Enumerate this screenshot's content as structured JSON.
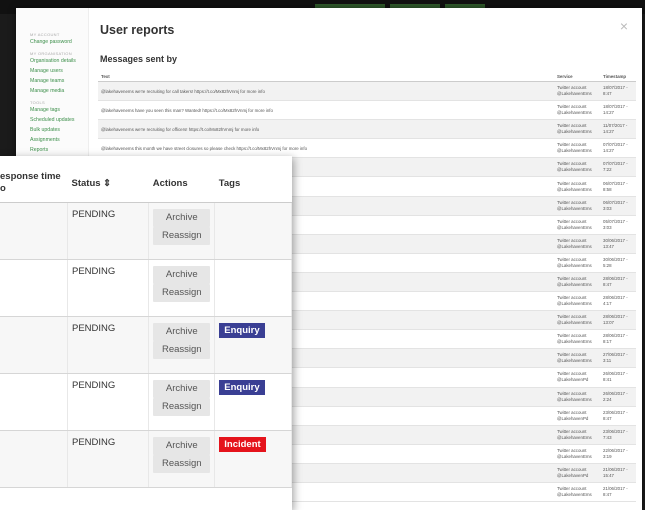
{
  "back": {
    "close_icon": "×",
    "sidebar": {
      "sec_account": "My Account",
      "change_password": "Change password",
      "sec_org": "My Organisation",
      "links": [
        "Organisation details",
        "Manage users",
        "Manage teams",
        "Manage media"
      ],
      "sec_tools": "Tools",
      "links2": [
        "Manage tags",
        "Scheduled updates",
        "Bulk updates",
        "Assignments",
        "Reports"
      ]
    },
    "title": "User reports",
    "subtitle": "Messages sent by",
    "columns": [
      "Text",
      "Service",
      "Timestamp"
    ],
    "rows": [
      {
        "text": "@lakehavenems we're recruiting for call takers! https://t.co/Mx82hVnmj for more info",
        "service": "Twitter account @LakehavenEms",
        "ts": "18/07/2017 - 8:47"
      },
      {
        "text": "@lakehavenems have you seen this man? Wanted! https://t.co/Mx82hVnmj for more info",
        "service": "Twitter account @LakehavenEms",
        "ts": "18/07/2017 - 14:27"
      },
      {
        "text": "@lakehavenems we're recruiting for officers! https://t.co/Mx82hVnmj for more info",
        "service": "Twitter account @LakehavenEms",
        "ts": "11/07/2017 - 14:27"
      },
      {
        "text": "@lakehavenems this month we have street closures so please check https://t.co/Mx82hVnmj for more info",
        "service": "Twitter account @LakehavenEms",
        "ts": "07/07/2017 - 14:27"
      },
      {
        "text": "s/Mx82hVnmj for more info",
        "service": "Twitter account @LakehavenEms",
        "ts": "07/07/2017 - 7:22"
      },
      {
        "text": "co/Mx82hVnmj for more info",
        "service": "Twitter account @LakehavenEms",
        "ts": "06/07/2017 - 8:58"
      },
      {
        "text": "info",
        "service": "Twitter account @LakehavenEms",
        "ts": "06/07/2017 - 3:03"
      },
      {
        "text": "more info",
        "service": "Twitter account @LakehavenEms",
        "ts": "05/07/2017 - 3:03"
      },
      {
        "text": "Mx82hVnmj for more info",
        "service": "Twitter account @LakehavenEms",
        "ts": "30/06/2017 - 13:47"
      },
      {
        "text": "Mx82hVnmj for more info",
        "service": "Twitter account @LakehavenEms",
        "ts": "30/06/2017 - 5:28"
      },
      {
        "text": "re info",
        "service": "Twitter account @LakehavenEms",
        "ts": "28/06/2017 - 8:47"
      },
      {
        "text": "more info",
        "service": "Twitter account @LakehavenEms",
        "ts": "28/06/2017 - 4:17"
      },
      {
        "text": "for more info",
        "service": "Twitter account @LakehavenEms",
        "ts": "28/06/2017 - 13:07"
      },
      {
        "text": "info",
        "service": "Twitter account @LakehavenEms",
        "ts": "28/06/2017 - 8:17"
      },
      {
        "text": "for more info",
        "service": "Twitter account @LakehavenEms",
        "ts": "27/06/2017 - 3:11"
      },
      {
        "text": "for more info",
        "service": "Twitter account @LakehavenPd",
        "ts": "26/06/2017 - 8:41"
      },
      {
        "text": "co/Mx82hVnmj for more info",
        "service": "Twitter account @LakehavenEms",
        "ts": "26/06/2017 - 2:24"
      },
      {
        "text": "/TUbXa for more info",
        "service": "Twitter account @LakehavenPd",
        "ts": "23/06/2017 - 8:47"
      },
      {
        "text": "for more info",
        "service": "Twitter account @LakehavenEms",
        "ts": "23/06/2017 - 7:43"
      },
      {
        "text": "for more info",
        "service": "Twitter account @LakehavenEms",
        "ts": "22/06/2017 - 3:19"
      },
      {
        "text": "",
        "service": "Twitter account @LakehavenPd",
        "ts": "21/06/2017 - 15:47"
      },
      {
        "text": "",
        "service": "Twitter account @LakehavenEms",
        "ts": "21/06/2017 - 8:47"
      }
    ]
  },
  "front": {
    "columns": {
      "response": "esponse time",
      "response_sub": "o",
      "status": "Status ⇕",
      "actions": "Actions",
      "tags": "Tags"
    },
    "rows": [
      {
        "status": "PENDING",
        "archive": "Archive",
        "reassign": "Reassign",
        "tag": "",
        "tag_color": ""
      },
      {
        "status": "PENDING",
        "archive": "Archive",
        "reassign": "Reassign",
        "tag": "",
        "tag_color": ""
      },
      {
        "status": "PENDING",
        "archive": "Archive",
        "reassign": "Reassign",
        "tag": "Enquiry",
        "tag_color": "#3a3f94"
      },
      {
        "status": "PENDING",
        "archive": "Archive",
        "reassign": "Reassign",
        "tag": "Enquiry",
        "tag_color": "#3a3f94"
      },
      {
        "status": "PENDING",
        "archive": "Archive",
        "reassign": "Reassign",
        "tag": "Incident",
        "tag_color": "#e5141c"
      }
    ]
  }
}
